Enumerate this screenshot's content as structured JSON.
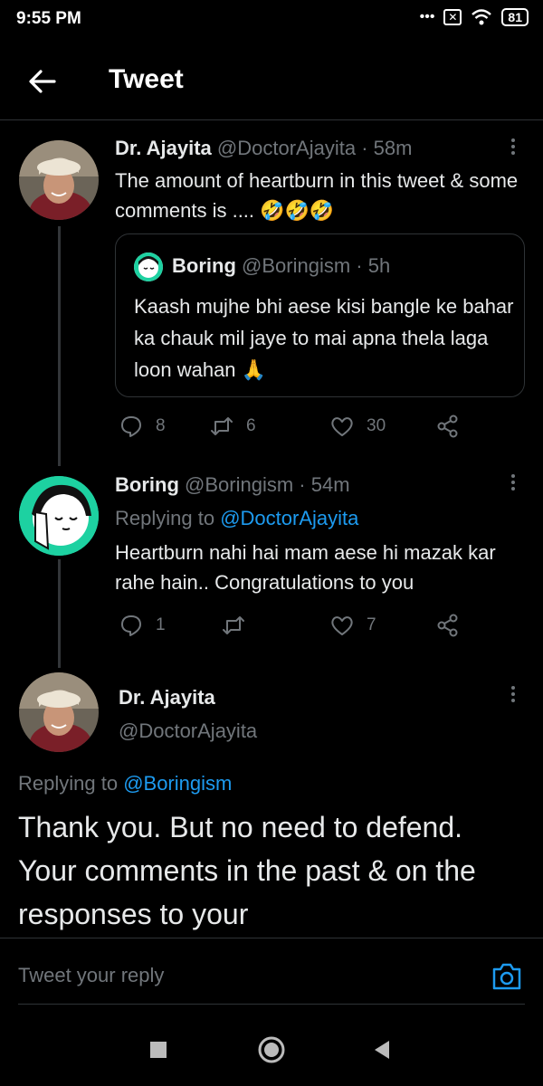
{
  "status_bar": {
    "time": "9:55 PM",
    "battery": "81",
    "dots": "•••"
  },
  "header": {
    "title": "Tweet"
  },
  "tweet1": {
    "name": "Dr. Ajayita",
    "handle": "@DoctorAjayita",
    "time": "· 58m",
    "text": "The amount of heartburn in this tweet & some comments is .... 🤣🤣🤣",
    "quote": {
      "name": "Boring",
      "handle": "@Boringism",
      "time": "· 5h",
      "text": "Kaash mujhe bhi aese kisi bangle ke bahar ka chauk mil jaye to mai apna thela laga loon wahan 🙏"
    },
    "reply_count": "8",
    "retweet_count": "6",
    "like_count": "30"
  },
  "tweet2": {
    "name": "Boring",
    "handle": "@Boringism",
    "time": "· 54m",
    "replying_prefix": "Replying to ",
    "replying_to": "@DoctorAjayita",
    "text": "Heartburn nahi hai mam aese hi mazak kar rahe hain.. Congratulations to you",
    "reply_count": "1",
    "like_count": "7"
  },
  "tweet3": {
    "name": "Dr. Ajayita",
    "handle": "@DoctorAjayita",
    "replying_prefix": "Replying to ",
    "replying_to": "@Boringism",
    "text": "Thank you. But no need to defend. Your comments in the past & on the responses to your"
  },
  "reply_bar": {
    "placeholder": "Tweet your reply"
  },
  "icons": {
    "back": "arrow-left-icon",
    "more": "more-vertical-icon",
    "reply": "reply-icon",
    "retweet": "retweet-icon",
    "like": "heart-icon",
    "share": "share-icon",
    "camera": "camera-icon"
  },
  "colors": {
    "background": "#000000",
    "accent": "#1d9bf0",
    "muted": "#71767b"
  }
}
